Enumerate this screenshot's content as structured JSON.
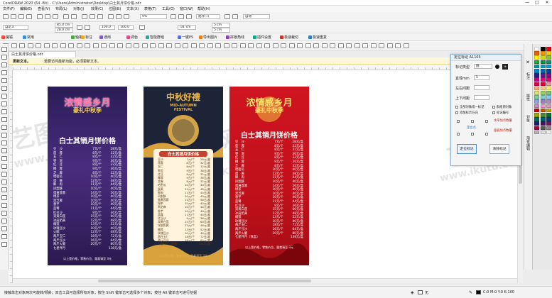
{
  "window": {
    "title": "CorelDRAW 2020 (64 -Bit) - C:\\Users\\Administrator\\Desktop\\白士其月饼价格.cdr",
    "min": "—",
    "max": "□",
    "close": "✕"
  },
  "menu": [
    "文件(F)",
    "编辑(E)",
    "查看(V)",
    "布局(L)",
    "对象(J)",
    "效果(C)",
    "位图(B)",
    "文本(X)",
    "表格(T)",
    "工具(O)",
    "窗口(W)",
    "帮助(H)"
  ],
  "toolbar1": {
    "zoom": "9%",
    "snap": "贴齐(T)",
    "auto": "自动"
  },
  "propbar": {
    "preset": "自定义",
    "x": "85.0 cm",
    "y": "28.0 cm",
    "w": "100.0",
    "h": "100.0",
    "angle": ".01 cm",
    "nudge1": "5 cm",
    "nudge2": "5 cm"
  },
  "plugins": [
    "魔镜",
    "常用",
    "轴格",
    "标注",
    "通用",
    "调色",
    "智能群组",
    "一键PS",
    "导出图片",
    "拼版角线",
    "插件设置",
    "极速裁切",
    "极速重复"
  ],
  "plugin_colors": [
    "#e94b3c",
    "#3a8fd8",
    "#48a93e",
    "#f0a22b",
    "#7c59c8",
    "#d94d8c",
    "#2aa5a0",
    "#5b6fd6",
    "#e67e22",
    "#8e44ad",
    "#16a085",
    "#c0392b",
    "#2980b9"
  ],
  "document_tab": "白士其月饼价格.cdr",
  "notice": {
    "bold": "更新文本。",
    "text": "若要访问最新功能，必须更新文本。"
  },
  "watermarks": [
    "艺图网",
    "www.ikutu.com"
  ],
  "posters": [
    {
      "headline_top": "浓情感乡月",
      "headline_sub": "豪礼中秋季",
      "title": "白士其销月饼价格",
      "rows": [
        [
          "豆　沙",
          "7元/个",
          "28元/盒"
        ],
        [
          "莲　蓉",
          "8元/个",
          "32元/盒"
        ],
        [
          "五　仁",
          "8元/个",
          "32元/盒"
        ],
        [
          "枣　泥",
          "9元/个",
          "36元/盒"
        ],
        [
          "红　豆",
          "8元/个",
          "32元/盒"
        ],
        [
          "椰　蓉",
          "9元/个",
          "36元/盒"
        ],
        [
          "芝　麻",
          "8元/个",
          "32元/盒"
        ],
        [
          "哈密瓜",
          "10元/个",
          "40元/盒"
        ],
        [
          "蛋　黄",
          "12元/个",
          "48元/盒"
        ],
        [
          "鲜　肉",
          "11元/个",
          "44元/盒"
        ],
        [
          "凤梨酥",
          "10元/个",
          "40元/盒"
        ],
        [
          "蛋黄莲蓉",
          "14元/个",
          "56元/盒"
        ],
        [
          "绿茶",
          "10元/个",
          "40元/盒"
        ],
        [
          "黑芝麻",
          "10元/个",
          "40元/盒"
        ],
        [
          "香芋",
          "10元/个",
          "40元/盒"
        ],
        [
          "蓝莓",
          "11元/个",
          "44元/盒"
        ],
        [
          "红豆沙",
          "9元/个",
          "36元/盒"
        ],
        [
          "双黄白莲",
          "15元/个",
          "60元/盒"
        ],
        [
          "冰皮奶黄",
          "12元/个",
          "48元/盒"
        ],
        [
          "榴莲",
          "13元/个",
          "52元/盒"
        ],
        [
          "玫瑰豆沙",
          "10元/个",
          "40元/盒"
        ],
        [
          "火腿",
          "12元/个",
          "48元/盒"
        ],
        [
          "两斤五仁",
          "18元/个",
          "72元/盒"
        ],
        [
          "两斤豆沙",
          "16元/个",
          "64元/盒"
        ],
        [
          "两斤火腿",
          "20元/个",
          "80元/盒"
        ],
        [
          "七星伴月",
          "",
          "138元/盒"
        ]
      ],
      "footer": "以上是价格，零售价位、量裁请至 3元"
    },
    {
      "headline_top": "中秋好禮",
      "headline_sub": "MID-AUTUMN FESTIVAL",
      "title": "白士其销月饼价格",
      "rows": [
        [
          "豆沙",
          "7元/个",
          "28元/盒"
        ],
        [
          "莲蓉",
          "8元/个",
          "32元/盒"
        ],
        [
          "五仁",
          "8元/个",
          "32元/盒"
        ],
        [
          "枣泥",
          "9元/个",
          "36元/盒"
        ],
        [
          "红豆",
          "8元/个",
          "32元/盒"
        ],
        [
          "椰蓉",
          "9元/个",
          "36元/盒"
        ],
        [
          "芝麻",
          "8元/个",
          "32元/盒"
        ],
        [
          "哈密瓜",
          "10元/个",
          "40元/盒"
        ],
        [
          "蛋黄",
          "12元/个",
          "48元/盒"
        ],
        [
          "鲜肉",
          "11元/个",
          "44元/盒"
        ],
        [
          "凤梨酥",
          "10元/个",
          "40元/盒"
        ],
        [
          "蛋黄莲蓉",
          "14元/个",
          "56元/盒"
        ],
        [
          "绿茶",
          "10元/个",
          "40元/盒"
        ],
        [
          "黑芝麻",
          "10元/个",
          "40元/盒"
        ],
        [
          "香芋",
          "10元/个",
          "40元/盒"
        ],
        [
          "蓝莓",
          "11元/个",
          "44元/盒"
        ],
        [
          "红豆沙",
          "9元/个",
          "36元/盒"
        ],
        [
          "双黄白莲",
          "15元/个",
          "60元/盒"
        ],
        [
          "冰皮奶黄",
          "12元/个",
          "48元/盒"
        ],
        [
          "榴莲",
          "13元/个",
          "52元/盒"
        ],
        [
          "玫瑰豆沙",
          "10元/个",
          "40元/盒"
        ],
        [
          "两斤五仁",
          "18元/个",
          "72元/盒"
        ],
        [
          "两斤豆沙",
          "16元/个",
          "64元/盒"
        ],
        [
          "七星伴月（铁盒）",
          "",
          "138元/盒"
        ]
      ],
      "footer": "以上是价格，零售价位、量裁请至 3元"
    },
    {
      "headline_top": "浓情感乡月",
      "headline_sub": "豪礼中秋季",
      "title": "白士其销月饼价格",
      "rows": [
        [
          "豆　沙",
          "7元/个",
          "28元/盒"
        ],
        [
          "莲　蓉",
          "8元/个",
          "32元/盒"
        ],
        [
          "五　仁",
          "8元/个",
          "32元/盒"
        ],
        [
          "枣　泥",
          "9元/个",
          "36元/盒"
        ],
        [
          "红　豆",
          "8元/个",
          "32元/盒"
        ],
        [
          "椰　蓉",
          "9元/个",
          "36元/盒"
        ],
        [
          "芝　麻",
          "8元/个",
          "32元/盒"
        ],
        [
          "哈密瓜",
          "10元/个",
          "40元/盒"
        ],
        [
          "蛋　黄",
          "12元/个",
          "48元/盒"
        ],
        [
          "鲜　肉",
          "11元/个",
          "44元/盒"
        ],
        [
          "凤梨酥",
          "10元/个",
          "40元/盒"
        ],
        [
          "蛋黄莲蓉",
          "14元/个",
          "56元/盒"
        ],
        [
          "绿茶",
          "10元/个",
          "40元/盒"
        ],
        [
          "黑芝麻",
          "10元/个",
          "40元/盒"
        ],
        [
          "香芋",
          "10元/个",
          "40元/盒"
        ],
        [
          "蓝莓",
          "11元/个",
          "44元/盒"
        ],
        [
          "红豆沙",
          "9元/个",
          "36元/盒"
        ],
        [
          "双黄白莲",
          "15元/个",
          "60元/盒"
        ],
        [
          "冰皮奶黄",
          "12元/个",
          "48元/盒"
        ],
        [
          "榴莲",
          "13元/个",
          "52元/盒"
        ],
        [
          "玫瑰豆沙",
          "10元/个",
          "40元/盒"
        ],
        [
          "两斤五仁",
          "18元/个",
          "72元/盒"
        ],
        [
          "两斤豆沙",
          "16元/个",
          "64元/盒"
        ],
        [
          "两斤火腿",
          "20元/个",
          "80元/盒"
        ],
        [
          "七星伴月（铁盒）",
          "",
          "138元/盒"
        ]
      ],
      "footer": "以上是价格，零售价位、量裁请至 3元"
    }
  ],
  "panel": {
    "title": "定位标记 A1103",
    "type_label": "标记类型",
    "type_value": "圆",
    "diameter_label": "直径mm",
    "diameter_value": "5",
    "left_right_label": "左右间距",
    "left_right_value": "",
    "top_bottom_label": "上下间距",
    "top_bottom_value": "",
    "opt1": "全部对象或一标记",
    "opt2": "群组原对象",
    "opt3": "添加标示方向",
    "opt4": "标记编号",
    "opt5": "定位点",
    "opt6": "水平加点数量",
    "opt7": "垂直加点数量",
    "btn_apply": "定位标记",
    "btn_clear": "清除标记"
  },
  "dock_tabs": [
    "标注",
    "属性",
    "对象",
    "渐变编辑"
  ],
  "palette_colors": [
    "#ffffff",
    "#000000",
    "#e60012",
    "#eb6100",
    "#f39800",
    "#fcc800",
    "#fff100",
    "#cfdb00",
    "#8fc31f",
    "#22ac38",
    "#009944",
    "#009b6b",
    "#009e96",
    "#00a0c1",
    "#00a0e9",
    "#0086d1",
    "#0068b7",
    "#00479d",
    "#1d2088",
    "#601986",
    "#920783",
    "#be0081",
    "#e4007f",
    "#e5006a",
    "#e5004f",
    "#e60033",
    "#f29c9f",
    "#f6b37f",
    "#facd89",
    "#fff45c",
    "#d8e17c",
    "#9cd05a",
    "#80c269",
    "#89c997",
    "#7dd0cc",
    "#7ecef4",
    "#8fa5d8",
    "#8f82bc",
    "#aa89bd",
    "#c490bf",
    "#e89ccb",
    "#e997b8",
    "#c7000b",
    "#c45c00",
    "#c8a200",
    "#a2a600",
    "#4d8b31",
    "#00752e",
    "#006b5f",
    "#005a7a",
    "#003f87",
    "#1a1a6e",
    "#4a1069",
    "#7a1065",
    "#a3003e",
    "#595757",
    "#898989",
    "#b5b5b6",
    "#dcdddd",
    "#efefef"
  ],
  "status": {
    "text": "接触单击对象两次可旋转/倾斜；双击工具可选择所有对象；按住 Shift 键单击可选择多个对象；按住 Alt 键单击可进行挖掘",
    "fill": "无",
    "color": "C:0 M:0 Y:0 K:100"
  }
}
